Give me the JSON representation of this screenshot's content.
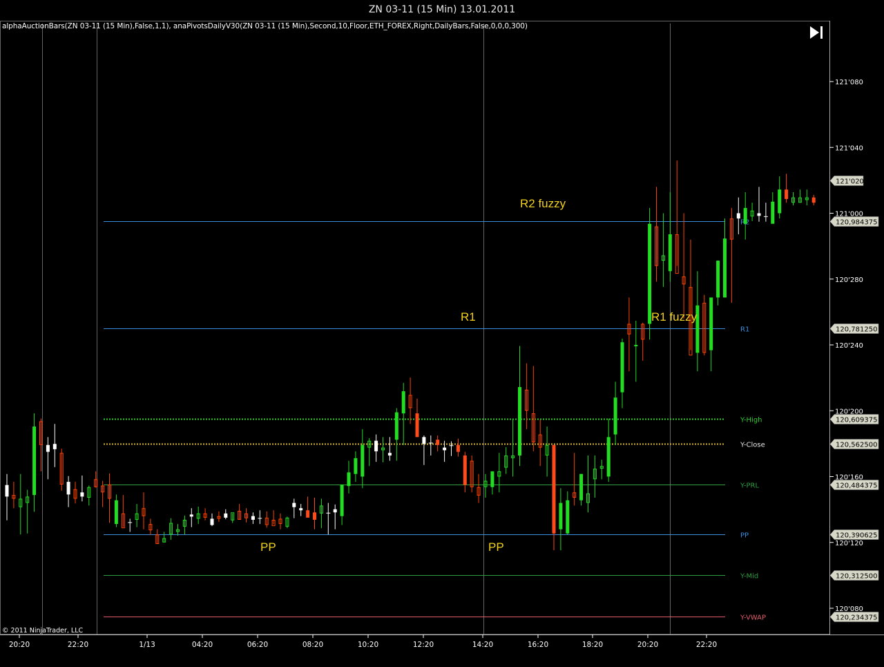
{
  "window": {
    "title": "ZN 03-11 (15 Min)  13.01.2011"
  },
  "indicators_label": "alphaAuctionBars(ZN 03-11 (15 Min),False,1,1), anaPivotsDailyV30(ZN 03-11 (15 Min),Second,10,Floor,ETH_FOREX,Right,DailyBars,False,0,0,0,300)",
  "copyright": "© 2011 NinjaTrader, LLC",
  "colors": {
    "background": "#000000",
    "up_candle": "#22dd22",
    "down_candle": "#ff4400",
    "neutral_candle": "#ffffff",
    "resistance_line": "#3a8ee0",
    "support_line": "#2e9e3e",
    "vwap_line": "#e05a6a",
    "y_high": "#33cc33",
    "y_close": "#d6b53a",
    "annotation": "#f2d21e",
    "axis_text": "#ffffff",
    "grid": "#ffffff"
  },
  "chart_data": {
    "type": "candlestick",
    "y_axis_ticks": [
      "121'080",
      "121'040",
      "121'000",
      "120'280",
      "120'240",
      "120'200",
      "120'160",
      "120'120",
      "120'080"
    ],
    "x_axis_ticks": [
      "20:20",
      "22:20",
      "1/13",
      "04:20",
      "06:20",
      "08:20",
      "10:20",
      "12:20",
      "14:20",
      "16:20",
      "18:20",
      "20:20",
      "22:20"
    ],
    "price_lines": [
      {
        "label": "R2",
        "value": "120,984375",
        "style": "solid",
        "color": "#3a8ee0"
      },
      {
        "label": "R1",
        "value": "120,781250",
        "style": "solid",
        "color": "#3a8ee0"
      },
      {
        "label": "Y-High",
        "value": "120,609375",
        "style": "dotted",
        "color": "#33cc33"
      },
      {
        "label": "Y-Close",
        "value": "120,562500",
        "style": "dotted",
        "color": "#d6b53a"
      },
      {
        "label": "Y-PRL",
        "value": "120,484375",
        "style": "solid",
        "color": "#2e9e3e"
      },
      {
        "label": "PP",
        "value": "120,390625",
        "style": "solid",
        "color": "#3a8ee0"
      },
      {
        "label": "Y-Mid",
        "value": "120,312500",
        "style": "solid",
        "color": "#2e9e3e"
      },
      {
        "label": "Y-VWAP",
        "value": "120,234375",
        "style": "solid",
        "color": "#e05a6a"
      }
    ],
    "current_price_label": "121'020",
    "annotations": [
      "R2 fuzzy",
      "R1",
      "R1 fuzzy",
      "PP",
      "PP"
    ],
    "session_dividers": [
      "20:50",
      "22:50",
      "14:20",
      "20:50"
    ],
    "candles": [
      {
        "o": 120.484,
        "h": 120.505,
        "l": 120.417,
        "c": 120.462,
        "t": "n"
      },
      {
        "o": 120.465,
        "h": 120.49,
        "l": 120.44,
        "c": 120.458,
        "t": "d"
      },
      {
        "o": 120.442,
        "h": 120.505,
        "l": 120.39,
        "c": 120.458,
        "t": "u"
      },
      {
        "o": 120.45,
        "h": 120.475,
        "l": 120.392,
        "c": 120.462,
        "t": "u"
      },
      {
        "o": 120.465,
        "h": 120.62,
        "l": 120.433,
        "c": 120.595,
        "t": "u"
      },
      {
        "o": 120.605,
        "h": 120.61,
        "l": 120.51,
        "c": 120.56,
        "t": "d"
      },
      {
        "o": 120.56,
        "h": 120.575,
        "l": 120.495,
        "c": 120.547,
        "t": "n"
      },
      {
        "o": 120.552,
        "h": 120.6,
        "l": 120.518,
        "c": 120.562,
        "t": "n"
      },
      {
        "o": 120.545,
        "h": 120.553,
        "l": 120.473,
        "c": 120.485,
        "t": "d"
      },
      {
        "o": 120.49,
        "h": 120.501,
        "l": 120.442,
        "c": 120.466,
        "t": "n"
      },
      {
        "o": 120.476,
        "h": 120.49,
        "l": 120.449,
        "c": 120.458,
        "t": "d"
      },
      {
        "o": 120.462,
        "h": 120.502,
        "l": 120.453,
        "c": 120.47,
        "t": "n"
      },
      {
        "o": 120.46,
        "h": 120.483,
        "l": 120.445,
        "c": 120.48,
        "t": "u"
      },
      {
        "o": 120.495,
        "h": 120.51,
        "l": 120.479,
        "c": 120.48,
        "t": "d"
      },
      {
        "o": 120.483,
        "h": 120.492,
        "l": 120.442,
        "c": 120.47,
        "t": "d"
      },
      {
        "o": 120.485,
        "h": 120.506,
        "l": 120.412,
        "c": 120.458,
        "t": "d"
      },
      {
        "o": 120.455,
        "h": 120.466,
        "l": 120.404,
        "c": 120.41,
        "t": "u"
      },
      {
        "o": 120.43,
        "h": 120.465,
        "l": 120.404,
        "c": 120.402,
        "t": "d"
      },
      {
        "o": 120.414,
        "h": 120.42,
        "l": 120.395,
        "c": 120.412,
        "t": "n"
      },
      {
        "o": 120.43,
        "h": 120.448,
        "l": 120.404,
        "c": 120.418,
        "t": "u"
      },
      {
        "o": 120.425,
        "h": 120.47,
        "l": 120.4,
        "c": 120.44,
        "t": "d"
      },
      {
        "o": 120.41,
        "h": 120.42,
        "l": 120.389,
        "c": 120.398,
        "t": "d"
      },
      {
        "o": 120.39,
        "h": 120.4,
        "l": 120.372,
        "c": 120.372,
        "t": "d"
      },
      {
        "o": 120.383,
        "h": 120.395,
        "l": 120.375,
        "c": 120.375,
        "t": "u"
      },
      {
        "o": 120.39,
        "h": 120.421,
        "l": 120.38,
        "c": 120.412,
        "t": "u"
      },
      {
        "o": 120.395,
        "h": 120.41,
        "l": 120.388,
        "c": 120.4,
        "t": "u"
      },
      {
        "o": 120.405,
        "h": 120.426,
        "l": 120.39,
        "c": 120.418,
        "t": "u"
      },
      {
        "o": 120.424,
        "h": 120.44,
        "l": 120.404,
        "c": 120.428,
        "t": "n"
      },
      {
        "o": 120.43,
        "h": 120.443,
        "l": 120.41,
        "c": 120.42,
        "t": "u"
      },
      {
        "o": 120.43,
        "h": 120.44,
        "l": 120.417,
        "c": 120.422,
        "t": "d"
      },
      {
        "o": 120.42,
        "h": 120.43,
        "l": 120.406,
        "c": 120.408,
        "t": "n"
      },
      {
        "o": 120.42,
        "h": 120.434,
        "l": 120.414,
        "c": 120.425,
        "t": "d"
      },
      {
        "o": 120.43,
        "h": 120.438,
        "l": 120.419,
        "c": 120.422,
        "t": "n"
      },
      {
        "o": 120.417,
        "h": 120.43,
        "l": 120.412,
        "c": 120.432,
        "t": "u"
      },
      {
        "o": 120.435,
        "h": 120.448,
        "l": 120.418,
        "c": 120.418,
        "t": "d"
      },
      {
        "o": 120.43,
        "h": 120.44,
        "l": 120.413,
        "c": 120.421,
        "t": "d"
      },
      {
        "o": 120.418,
        "h": 120.432,
        "l": 120.41,
        "c": 120.425,
        "t": "n"
      },
      {
        "o": 120.422,
        "h": 120.436,
        "l": 120.41,
        "c": 120.42,
        "t": "n"
      },
      {
        "o": 120.422,
        "h": 120.434,
        "l": 120.403,
        "c": 120.408,
        "t": "d"
      },
      {
        "o": 120.418,
        "h": 120.436,
        "l": 120.409,
        "c": 120.406,
        "t": "d"
      },
      {
        "o": 120.42,
        "h": 120.43,
        "l": 120.4,
        "c": 120.41,
        "t": "d"
      },
      {
        "o": 120.405,
        "h": 120.424,
        "l": 120.402,
        "c": 120.422,
        "t": "u"
      },
      {
        "o": 120.45,
        "h": 120.458,
        "l": 120.421,
        "c": 120.442,
        "t": "n"
      },
      {
        "o": 120.44,
        "h": 120.448,
        "l": 120.425,
        "c": 120.436,
        "t": "n"
      },
      {
        "o": 120.436,
        "h": 120.462,
        "l": 120.428,
        "c": 120.422,
        "t": "o"
      },
      {
        "o": 120.432,
        "h": 120.46,
        "l": 120.4,
        "c": 120.418,
        "t": "o"
      },
      {
        "o": 120.43,
        "h": 120.458,
        "l": 120.402,
        "c": 120.445,
        "t": "u"
      },
      {
        "o": 120.432,
        "h": 120.45,
        "l": 120.39,
        "c": 120.432,
        "t": "n"
      },
      {
        "o": 120.438,
        "h": 120.447,
        "l": 120.4,
        "c": 120.432,
        "t": "n"
      },
      {
        "o": 120.425,
        "h": 120.464,
        "l": 120.408,
        "c": 120.485,
        "t": "u"
      },
      {
        "o": 120.482,
        "h": 120.53,
        "l": 120.468,
        "c": 120.508,
        "t": "u"
      },
      {
        "o": 120.505,
        "h": 120.548,
        "l": 120.49,
        "c": 120.535,
        "t": "u"
      },
      {
        "o": 120.5,
        "h": 120.59,
        "l": 120.478,
        "c": 120.56,
        "t": "u"
      },
      {
        "o": 120.555,
        "h": 120.573,
        "l": 120.52,
        "c": 120.568,
        "t": "u"
      },
      {
        "o": 120.568,
        "h": 120.58,
        "l": 120.528,
        "c": 120.548,
        "t": "n"
      },
      {
        "o": 120.55,
        "h": 120.575,
        "l": 120.527,
        "c": 120.555,
        "t": "u"
      },
      {
        "o": 120.545,
        "h": 120.575,
        "l": 120.53,
        "c": 120.54,
        "t": "n"
      },
      {
        "o": 120.57,
        "h": 120.63,
        "l": 120.53,
        "c": 120.622,
        "t": "u"
      },
      {
        "o": 120.62,
        "h": 120.678,
        "l": 120.56,
        "c": 120.662,
        "t": "u"
      },
      {
        "o": 120.655,
        "h": 120.688,
        "l": 120.6,
        "c": 120.63,
        "t": "d"
      },
      {
        "o": 120.62,
        "h": 120.648,
        "l": 120.575,
        "c": 120.575,
        "t": "o"
      },
      {
        "o": 120.575,
        "h": 120.578,
        "l": 120.522,
        "c": 120.562,
        "t": "n"
      },
      {
        "o": 120.565,
        "h": 120.578,
        "l": 120.54,
        "c": 120.562,
        "t": "n"
      },
      {
        "o": 120.57,
        "h": 120.578,
        "l": 120.548,
        "c": 120.56,
        "t": "o"
      },
      {
        "o": 120.555,
        "h": 120.568,
        "l": 120.528,
        "c": 120.55,
        "t": "n"
      },
      {
        "o": 120.56,
        "h": 120.567,
        "l": 120.539,
        "c": 120.56,
        "t": "n"
      },
      {
        "o": 120.56,
        "h": 120.572,
        "l": 120.538,
        "c": 120.547,
        "t": "o"
      },
      {
        "o": 120.54,
        "h": 120.547,
        "l": 120.47,
        "c": 120.484,
        "t": "o"
      },
      {
        "o": 120.53,
        "h": 120.54,
        "l": 120.47,
        "c": 120.48,
        "t": "d"
      },
      {
        "o": 120.48,
        "h": 120.505,
        "l": 120.45,
        "c": 120.464,
        "t": "d"
      },
      {
        "o": 120.48,
        "h": 120.505,
        "l": 120.46,
        "c": 120.492,
        "t": "u"
      },
      {
        "o": 120.48,
        "h": 120.51,
        "l": 120.466,
        "c": 120.51,
        "t": "u"
      },
      {
        "o": 120.5,
        "h": 120.545,
        "l": 120.47,
        "c": 120.51,
        "t": "u"
      },
      {
        "o": 120.517,
        "h": 120.556,
        "l": 120.505,
        "c": 120.54,
        "t": "u"
      },
      {
        "o": 120.535,
        "h": 120.61,
        "l": 120.5,
        "c": 120.54,
        "t": "u"
      },
      {
        "o": 120.54,
        "h": 120.748,
        "l": 120.52,
        "c": 120.67,
        "t": "u"
      },
      {
        "o": 120.665,
        "h": 120.715,
        "l": 120.59,
        "c": 120.625,
        "t": "d"
      },
      {
        "o": 120.62,
        "h": 120.71,
        "l": 120.548,
        "c": 120.565,
        "t": "d"
      },
      {
        "o": 120.58,
        "h": 120.608,
        "l": 120.52,
        "c": 120.555,
        "t": "d"
      },
      {
        "o": 120.56,
        "h": 120.595,
        "l": 120.5,
        "c": 120.54,
        "t": "u"
      },
      {
        "o": 120.56,
        "h": 120.56,
        "l": 120.36,
        "c": 120.392,
        "t": "o"
      },
      {
        "o": 120.4,
        "h": 120.478,
        "l": 120.36,
        "c": 120.45,
        "t": "u"
      },
      {
        "o": 120.392,
        "h": 120.472,
        "l": 120.39,
        "c": 120.455,
        "t": "u"
      },
      {
        "o": 120.46,
        "h": 120.545,
        "l": 120.445,
        "c": 120.47,
        "t": "d"
      },
      {
        "o": 120.455,
        "h": 120.505,
        "l": 120.445,
        "c": 120.505,
        "t": "u"
      },
      {
        "o": 120.45,
        "h": 120.54,
        "l": 120.432,
        "c": 120.468,
        "t": "u"
      },
      {
        "o": 120.495,
        "h": 120.54,
        "l": 120.46,
        "c": 120.515,
        "t": "u"
      },
      {
        "o": 120.515,
        "h": 120.532,
        "l": 120.495,
        "c": 120.52,
        "t": "u"
      },
      {
        "o": 120.5,
        "h": 120.61,
        "l": 120.49,
        "c": 120.575,
        "t": "u"
      },
      {
        "o": 120.58,
        "h": 120.68,
        "l": 120.56,
        "c": 120.65,
        "t": "u"
      },
      {
        "o": 120.66,
        "h": 120.762,
        "l": 120.63,
        "c": 120.755,
        "t": "u"
      },
      {
        "o": 120.77,
        "h": 120.84,
        "l": 120.7,
        "c": 120.79,
        "t": "d"
      },
      {
        "o": 120.75,
        "h": 120.796,
        "l": 120.68,
        "c": 120.75,
        "t": "u"
      },
      {
        "o": 120.76,
        "h": 120.792,
        "l": 120.72,
        "c": 120.79,
        "t": "d"
      },
      {
        "o": 120.79,
        "h": 121.01,
        "l": 120.76,
        "c": 120.98,
        "t": "u"
      },
      {
        "o": 120.975,
        "h": 121.05,
        "l": 120.87,
        "c": 120.9,
        "t": "d"
      },
      {
        "o": 120.91,
        "h": 121.0,
        "l": 120.86,
        "c": 120.92,
        "t": "u"
      },
      {
        "o": 120.89,
        "h": 121.04,
        "l": 120.87,
        "c": 120.96,
        "t": "u"
      },
      {
        "o": 120.96,
        "h": 121.1,
        "l": 120.9,
        "c": 120.885,
        "t": "d"
      },
      {
        "o": 120.88,
        "h": 121.0,
        "l": 120.8,
        "c": 120.865,
        "t": "d"
      },
      {
        "o": 120.86,
        "h": 120.95,
        "l": 120.74,
        "c": 120.73,
        "t": "d"
      },
      {
        "o": 120.735,
        "h": 120.89,
        "l": 120.7,
        "c": 120.825,
        "t": "u"
      },
      {
        "o": 120.83,
        "h": 120.845,
        "l": 120.73,
        "c": 120.735,
        "t": "d"
      },
      {
        "o": 120.74,
        "h": 120.84,
        "l": 120.7,
        "c": 120.84,
        "t": "u"
      },
      {
        "o": 120.84,
        "h": 120.91,
        "l": 120.825,
        "c": 120.91,
        "t": "u"
      },
      {
        "o": 120.84,
        "h": 120.99,
        "l": 120.84,
        "c": 120.952,
        "t": "u"
      },
      {
        "o": 120.95,
        "h": 121.01,
        "l": 120.83,
        "c": 120.99,
        "t": "d"
      },
      {
        "o": 120.99,
        "h": 121.03,
        "l": 120.96,
        "c": 121.0,
        "t": "n"
      },
      {
        "o": 120.98,
        "h": 121.04,
        "l": 120.95,
        "c": 121.01,
        "t": "u"
      },
      {
        "o": 121.005,
        "h": 121.02,
        "l": 120.985,
        "c": 120.994,
        "t": "u"
      },
      {
        "o": 121.0,
        "h": 121.05,
        "l": 120.984,
        "c": 120.995,
        "t": "n"
      },
      {
        "o": 120.995,
        "h": 121.02,
        "l": 120.984,
        "c": 120.995,
        "t": "n"
      },
      {
        "o": 120.98,
        "h": 121.04,
        "l": 120.985,
        "c": 121.022,
        "t": "u"
      },
      {
        "o": 121.0,
        "h": 121.07,
        "l": 120.99,
        "c": 121.045,
        "t": "u"
      },
      {
        "o": 121.045,
        "h": 121.075,
        "l": 121.02,
        "c": 121.027,
        "t": "o"
      },
      {
        "o": 121.03,
        "h": 121.04,
        "l": 121.015,
        "c": 121.02,
        "t": "u"
      },
      {
        "o": 121.02,
        "h": 121.045,
        "l": 121.02,
        "c": 121.03,
        "t": "u"
      },
      {
        "o": 121.025,
        "h": 121.045,
        "l": 121.015,
        "c": 121.03,
        "t": "u"
      },
      {
        "o": 121.03,
        "h": 121.035,
        "l": 121.015,
        "c": 121.02,
        "t": "o"
      }
    ]
  }
}
